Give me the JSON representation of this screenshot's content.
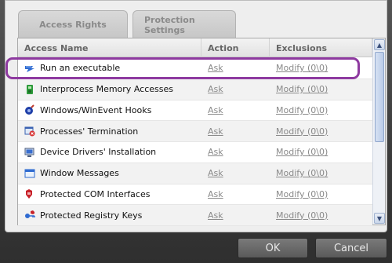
{
  "tabs": [
    {
      "label": "Access Rights"
    },
    {
      "label": "Protection Settings"
    }
  ],
  "columns": {
    "name": "Access Name",
    "action": "Action",
    "exclusions": "Exclusions"
  },
  "rows": [
    {
      "name": "Run an executable",
      "action": "Ask",
      "exclusions": "Modify (0\\0)",
      "icon": "executable-icon"
    },
    {
      "name": "Interprocess Memory Accesses",
      "action": "Ask",
      "exclusions": "Modify (0\\0)",
      "icon": "memory-icon"
    },
    {
      "name": "Windows/WinEvent Hooks",
      "action": "Ask",
      "exclusions": "Modify (0\\0)",
      "icon": "hook-icon"
    },
    {
      "name": "Processes' Termination",
      "action": "Ask",
      "exclusions": "Modify (0\\0)",
      "icon": "process-termination-icon"
    },
    {
      "name": "Device Drivers' Installation",
      "action": "Ask",
      "exclusions": "Modify (0\\0)",
      "icon": "device-driver-icon"
    },
    {
      "name": "Window Messages",
      "action": "Ask",
      "exclusions": "Modify (0\\0)",
      "icon": "window-messages-icon"
    },
    {
      "name": "Protected COM Interfaces",
      "action": "Ask",
      "exclusions": "Modify (0\\0)",
      "icon": "com-interface-icon"
    },
    {
      "name": "Protected Registry Keys",
      "action": "Ask",
      "exclusions": "Modify (0\\0)",
      "icon": "registry-keys-icon"
    }
  ],
  "buttons": {
    "ok": "OK",
    "cancel": "Cancel"
  },
  "colors": {
    "highlight": "#8e3aa0",
    "link": "#8a8a8a"
  }
}
